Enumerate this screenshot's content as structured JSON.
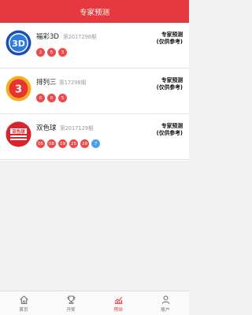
{
  "header": {
    "title": "专家预测"
  },
  "lotteries": [
    {
      "name": "福彩3D",
      "issue": "第2017298期",
      "balls": [
        "2",
        "5",
        "3"
      ],
      "blue": [],
      "tag1": "专家预测",
      "tag2": "(仅供参考)",
      "logo": "fucai-3d-logo",
      "logo_text": "3D"
    },
    {
      "name": "排列三",
      "issue": "第17298期",
      "balls": [
        "6",
        "0",
        "5"
      ],
      "blue": [],
      "tag1": "专家预测",
      "tag2": "(仅供参考)",
      "logo": "pailie3-logo",
      "logo_text": "3"
    },
    {
      "name": "双色球",
      "issue": "第2017129期",
      "balls": [
        "05",
        "08",
        "19",
        "25",
        "29"
      ],
      "blue": [
        "7"
      ],
      "tag1": "专家预测",
      "tag2": "(仅供参考)",
      "logo": "shuangseqiu-logo",
      "logo_text": "双色球"
    }
  ],
  "tabbar": [
    {
      "label": "首页",
      "icon": "home-icon",
      "active": false
    },
    {
      "label": "开奖",
      "icon": "trophy-icon",
      "active": false
    },
    {
      "label": "预测",
      "icon": "chart-icon",
      "active": true
    },
    {
      "label": "账户",
      "icon": "user-icon",
      "active": false
    }
  ],
  "colors": {
    "brand": "#e5383f",
    "red_ball": "#ef4a4a",
    "blue_ball": "#4a9ef0"
  }
}
